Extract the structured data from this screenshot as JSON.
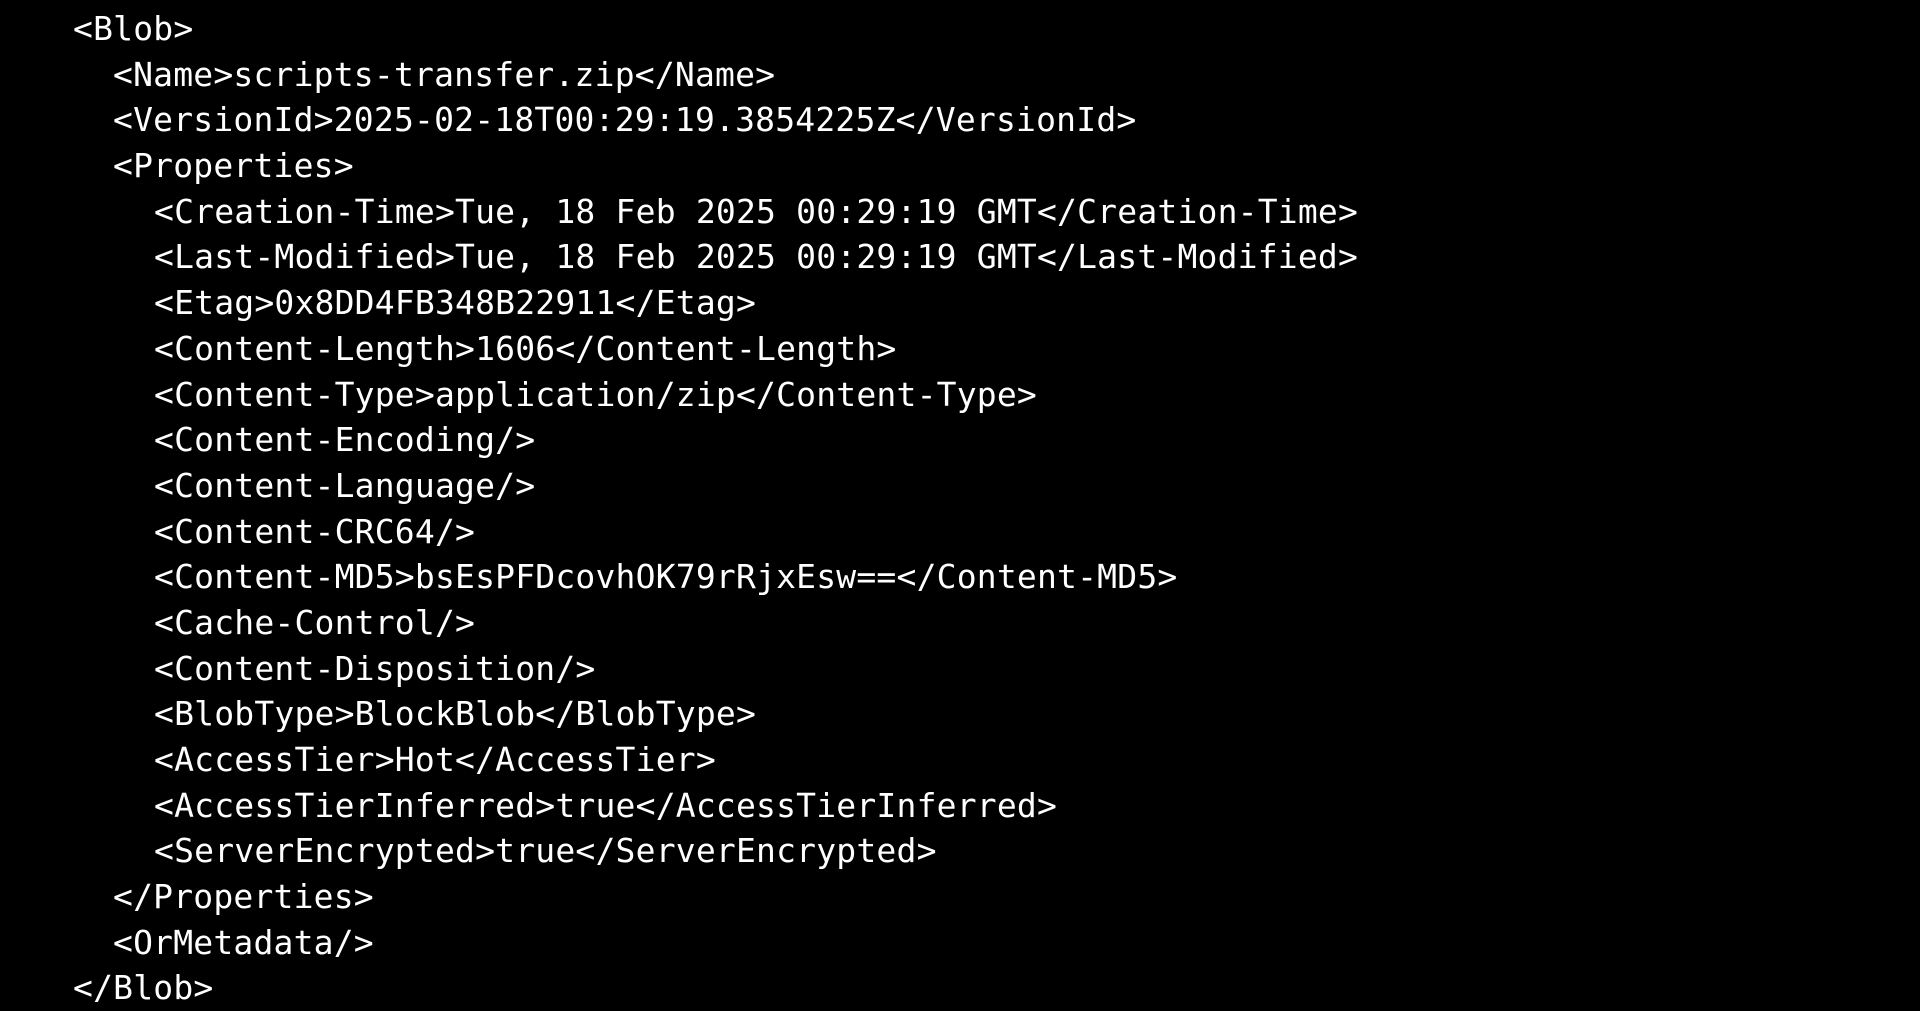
{
  "terminal": {
    "text_color": "#ffffff",
    "background_color": "#000000",
    "lines": [
      {
        "indent": 0,
        "text": "<Blob>"
      },
      {
        "indent": 1,
        "text": "<Name>scripts-transfer.zip</Name>"
      },
      {
        "indent": 1,
        "text": "<VersionId>2025-02-18T00:29:19.3854225Z</VersionId>"
      },
      {
        "indent": 1,
        "text": "<Properties>"
      },
      {
        "indent": 2,
        "text": "<Creation-Time>Tue, 18 Feb 2025 00:29:19 GMT</Creation-Time>"
      },
      {
        "indent": 2,
        "text": "<Last-Modified>Tue, 18 Feb 2025 00:29:19 GMT</Last-Modified>"
      },
      {
        "indent": 2,
        "text": "<Etag>0x8DD4FB348B22911</Etag>"
      },
      {
        "indent": 2,
        "text": "<Content-Length>1606</Content-Length>"
      },
      {
        "indent": 2,
        "text": "<Content-Type>application/zip</Content-Type>"
      },
      {
        "indent": 2,
        "text": "<Content-Encoding/>"
      },
      {
        "indent": 2,
        "text": "<Content-Language/>"
      },
      {
        "indent": 2,
        "text": "<Content-CRC64/>"
      },
      {
        "indent": 2,
        "text": "<Content-MD5>bsEsPFDcovhOK79rRjxEsw==</Content-MD5>"
      },
      {
        "indent": 2,
        "text": "<Cache-Control/>"
      },
      {
        "indent": 2,
        "text": "<Content-Disposition/>"
      },
      {
        "indent": 2,
        "text": "<BlobType>BlockBlob</BlobType>"
      },
      {
        "indent": 2,
        "text": "<AccessTier>Hot</AccessTier>"
      },
      {
        "indent": 2,
        "text": "<AccessTierInferred>true</AccessTierInferred>"
      },
      {
        "indent": 2,
        "text": "<ServerEncrypted>true</ServerEncrypted>"
      },
      {
        "indent": 1,
        "text": "</Properties>"
      },
      {
        "indent": 1,
        "text": "<OrMetadata/>"
      },
      {
        "indent": 0,
        "text": "</Blob>"
      }
    ]
  }
}
